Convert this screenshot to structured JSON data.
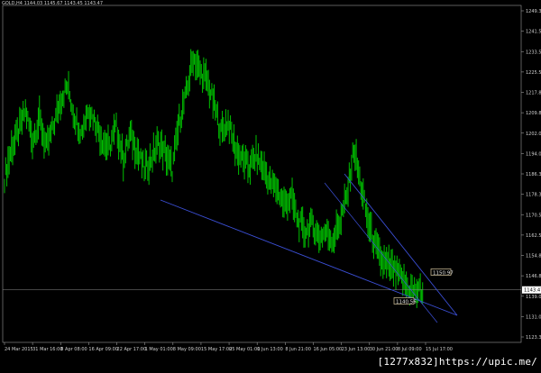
{
  "window": {
    "title": "GOLD,H4 1144.03 1145.67 1143.45 1143.47",
    "watermark": "[1277x832]https://upic.me/"
  },
  "colors": {
    "background": "#000000",
    "candle": "#00c000",
    "trendline": "#3b4fd6",
    "text": "#cfcfcf",
    "price_box_bg": "#ffffff",
    "price_box_text": "#000000"
  },
  "chart_data": {
    "type": "line",
    "title": "GOLD,H4 1144.03 1145.67 1143.45 1143.47",
    "symbol": "GOLD",
    "timeframe": "H4",
    "ohlc": {
      "open": 1144.03,
      "high": 1145.67,
      "low": 1143.45,
      "close": 1143.47
    },
    "ylim": [
      1124.0,
      1249.0
    ],
    "y_ticks": [
      "1249.30",
      "1241.55",
      "1233.50",
      "1225.55",
      "1217.80",
      "1209.80",
      "1202.05",
      "1194.05",
      "1186.30",
      "1178.30",
      "1170.55",
      "1162.55",
      "1154.80",
      "1146.85",
      "1139.05",
      "1131.05",
      "1123.30"
    ],
    "x_ticks": [
      "24 Mar 2015",
      "31 Mar 16:00",
      "8 Apr 08:00",
      "16 Apr 09:00",
      "22 Apr 17:00",
      "1 May 01:00",
      "8 May 09:00",
      "15 May 17:00",
      "25 May 01:00",
      "1 Jun 13:00",
      "8 Jun 21:00",
      "16 Jun 05:00",
      "23 Jun 13:00",
      "30 Jun 21:00",
      "8 Jul 09:00",
      "15 Jul 17:00"
    ],
    "x_index": [
      0,
      2,
      4,
      6,
      8,
      10,
      12,
      14,
      16,
      18,
      20,
      22,
      24,
      26,
      28,
      30,
      32,
      34,
      36,
      38,
      40,
      42,
      44,
      46,
      48,
      50,
      52,
      54,
      56,
      58,
      60,
      62,
      64,
      66,
      68,
      70,
      72,
      74,
      76,
      78,
      80,
      82,
      84,
      86,
      88,
      90,
      92,
      94,
      96,
      98,
      100,
      102,
      104,
      106,
      108,
      110,
      112,
      114,
      116,
      118,
      120
    ],
    "series": [
      {
        "values": [
          1185,
          1196,
          1202,
          1210,
          1199,
          1207,
          1196,
          1204,
          1214,
          1219,
          1208,
          1202,
          1211,
          1206,
          1199,
          1196,
          1204,
          1192,
          1201,
          1195,
          1188,
          1192,
          1198,
          1194,
          1188,
          1206,
          1216,
          1230,
          1224,
          1221,
          1212,
          1202,
          1206,
          1196,
          1192,
          1189,
          1193,
          1189,
          1183,
          1181,
          1175,
          1178,
          1169,
          1165,
          1168,
          1163,
          1165,
          1162,
          1169,
          1178,
          1196,
          1182,
          1169,
          1160,
          1154,
          1152,
          1150,
          1147,
          1143,
          1143,
          1143
        ]
      }
    ],
    "annotations": [
      {
        "label": "1150.97",
        "type": "price-marker"
      },
      {
        "label": "1140.56",
        "type": "price-marker"
      },
      {
        "label": "1143.47",
        "type": "current-price"
      }
    ],
    "grid": false
  }
}
